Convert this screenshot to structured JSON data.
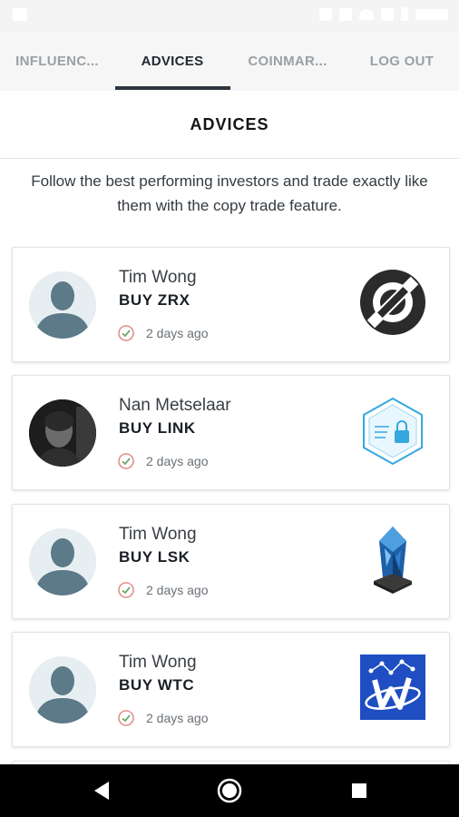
{
  "tabs": [
    {
      "label": "INFLUENC..."
    },
    {
      "label": "ADVICES"
    },
    {
      "label": "COINMAR..."
    },
    {
      "label": "LOG OUT"
    }
  ],
  "page": {
    "title": "ADVICES",
    "intro": "Follow the best performing investors and trade exactly like them with the copy trade feature."
  },
  "advices": [
    {
      "name": "Tim Wong",
      "advice": "BUY ZRX",
      "time": "2 days ago",
      "coin_icon": "0x-zrx-icon"
    },
    {
      "name": "Nan Metselaar",
      "advice": "BUY LINK",
      "time": "2 days ago",
      "coin_icon": "chainlink-icon"
    },
    {
      "name": "Tim Wong",
      "advice": "BUY LSK",
      "time": "2 days ago",
      "coin_icon": "lisk-icon"
    },
    {
      "name": "Tim Wong",
      "advice": "BUY WTC",
      "time": "2 days ago",
      "coin_icon": "walton-icon"
    }
  ],
  "colors": {
    "accent": "#2c3440",
    "avatar": "#5c7a87",
    "wtc_blue": "#1f4ec2"
  }
}
